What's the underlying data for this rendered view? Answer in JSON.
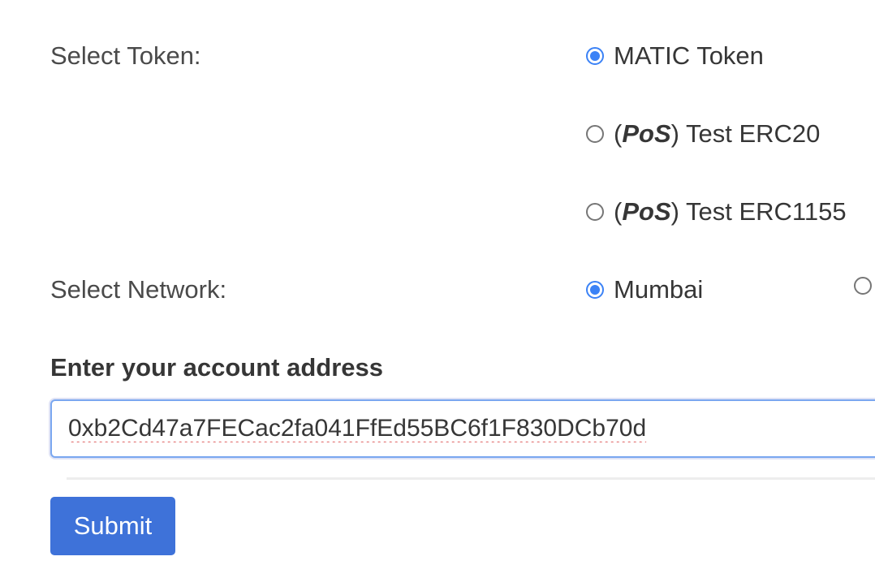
{
  "token": {
    "label": "Select Token:",
    "options": [
      {
        "prefix": "",
        "emph": "",
        "suffix": "MATIC Token",
        "checked": true
      },
      {
        "prefix": "(",
        "emph": "PoS",
        "suffix": ") Test ERC20",
        "checked": false
      },
      {
        "prefix": "(",
        "emph": "PoS",
        "suffix": ") Test ERC1155",
        "checked": false
      }
    ]
  },
  "network": {
    "label": "Select Network:",
    "options": [
      {
        "label": "Mumbai",
        "checked": true
      },
      {
        "label": "",
        "checked": false
      }
    ]
  },
  "address": {
    "label": "Enter your account address",
    "value": "0xb2Cd47a7FECac2fa041FfEd55BC6f1F830DCb70d"
  },
  "submit": {
    "label": "Submit"
  },
  "colors": {
    "accent": "#3b82f6",
    "button": "#3e72d9",
    "focus_border": "#7aa7f0"
  }
}
